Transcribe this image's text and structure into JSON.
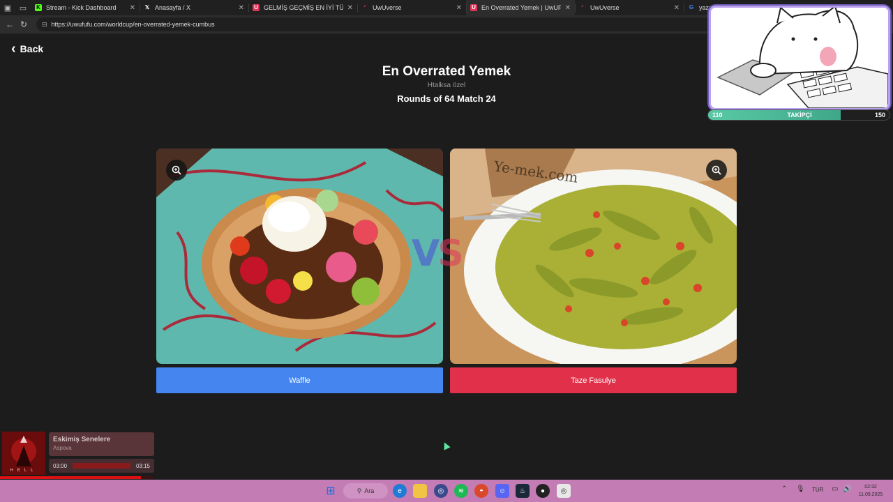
{
  "browser": {
    "tabs": [
      {
        "title": "Stream - Kick Dashboard",
        "icon": "kick-icon",
        "color": "#53fc18"
      },
      {
        "title": "Anasayfa / X",
        "icon": "x-icon",
        "color": "#ffffff"
      },
      {
        "title": "GELMİŞ GEÇMİŞ EN İYİ TÜRK DİZİ...",
        "icon": "uwufufu-icon",
        "color": "#e0335a"
      },
      {
        "title": "UwUverse",
        "icon": "uwuverse-icon",
        "color": "#e0335a"
      },
      {
        "title": "En Overrated Yemek | UwUFUFU",
        "icon": "uwufufu-icon",
        "color": "#e0335a"
      },
      {
        "title": "UwUverse",
        "icon": "uwuverse-icon",
        "color": "#e0335a"
      },
      {
        "title": "yazı tura - Google'da Ara",
        "icon": "google-icon",
        "color": "#4285f4"
      }
    ],
    "url": "https://uwufufu.com/worldcup/en-overrated-yemek-cumbus"
  },
  "page": {
    "back_label": "Back",
    "title": "En Overrated Yemek",
    "subtitle": "Htalksa özel",
    "rounds": "Rounds of 64 Match 24",
    "vs_text": "VS",
    "left_choice": {
      "label": "Waffle",
      "color": "#4585f0"
    },
    "right_choice": {
      "label": "Taze Fasulye",
      "color": "#e1314a"
    },
    "watermark": "Ye-mek.com"
  },
  "stream_overlay": {
    "followers_label": "TAKİPÇİ",
    "current": "110",
    "goal": "150",
    "progress": 0.73
  },
  "music": {
    "song": "Eskimiş Senelere",
    "artist": "Aspova",
    "elapsed": "03:00",
    "total": "03:15",
    "cover_text": "HELL",
    "progress": 0.92
  },
  "taskbar": {
    "search_label": "Ara",
    "lang": "TUR",
    "time": "02:32",
    "date": "11.09.2025"
  }
}
